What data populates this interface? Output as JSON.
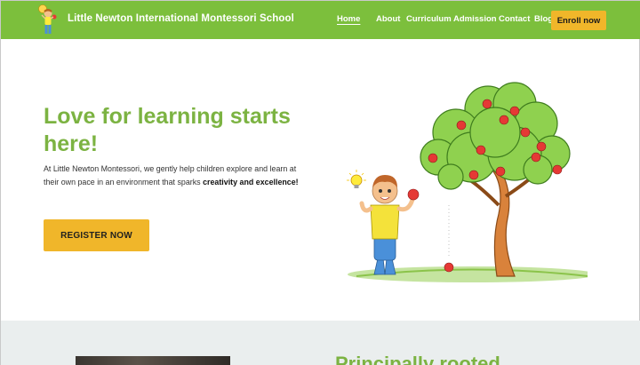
{
  "header": {
    "brand": "Little Newton International Montessori School",
    "nav": [
      {
        "label": "Home",
        "active": true
      },
      {
        "label": "About",
        "active": false
      },
      {
        "label": "Curriculum",
        "active": false
      },
      {
        "label": "Admission",
        "active": false
      },
      {
        "label": "Contact",
        "active": false
      },
      {
        "label": "Blog",
        "active": false
      }
    ],
    "enroll_label": "Enroll now"
  },
  "hero": {
    "title": "Love for learning starts here!",
    "text_plain": "At Little Newton Montessori, we gently help children explore and learn at their own pace in an environment that sparks ",
    "text_bold": "creativity and excellence!",
    "register_label": "REGISTER NOW"
  },
  "next_section": {
    "title": "Principally rooted"
  },
  "colors": {
    "header_green": "#7cbf3c",
    "title_green": "#7cb342",
    "button_yellow": "#f0b62a",
    "band_gray": "#eaeeee"
  },
  "icons": {
    "logo": "boy-with-apple-logo",
    "illustration": "boy-under-apple-tree"
  }
}
